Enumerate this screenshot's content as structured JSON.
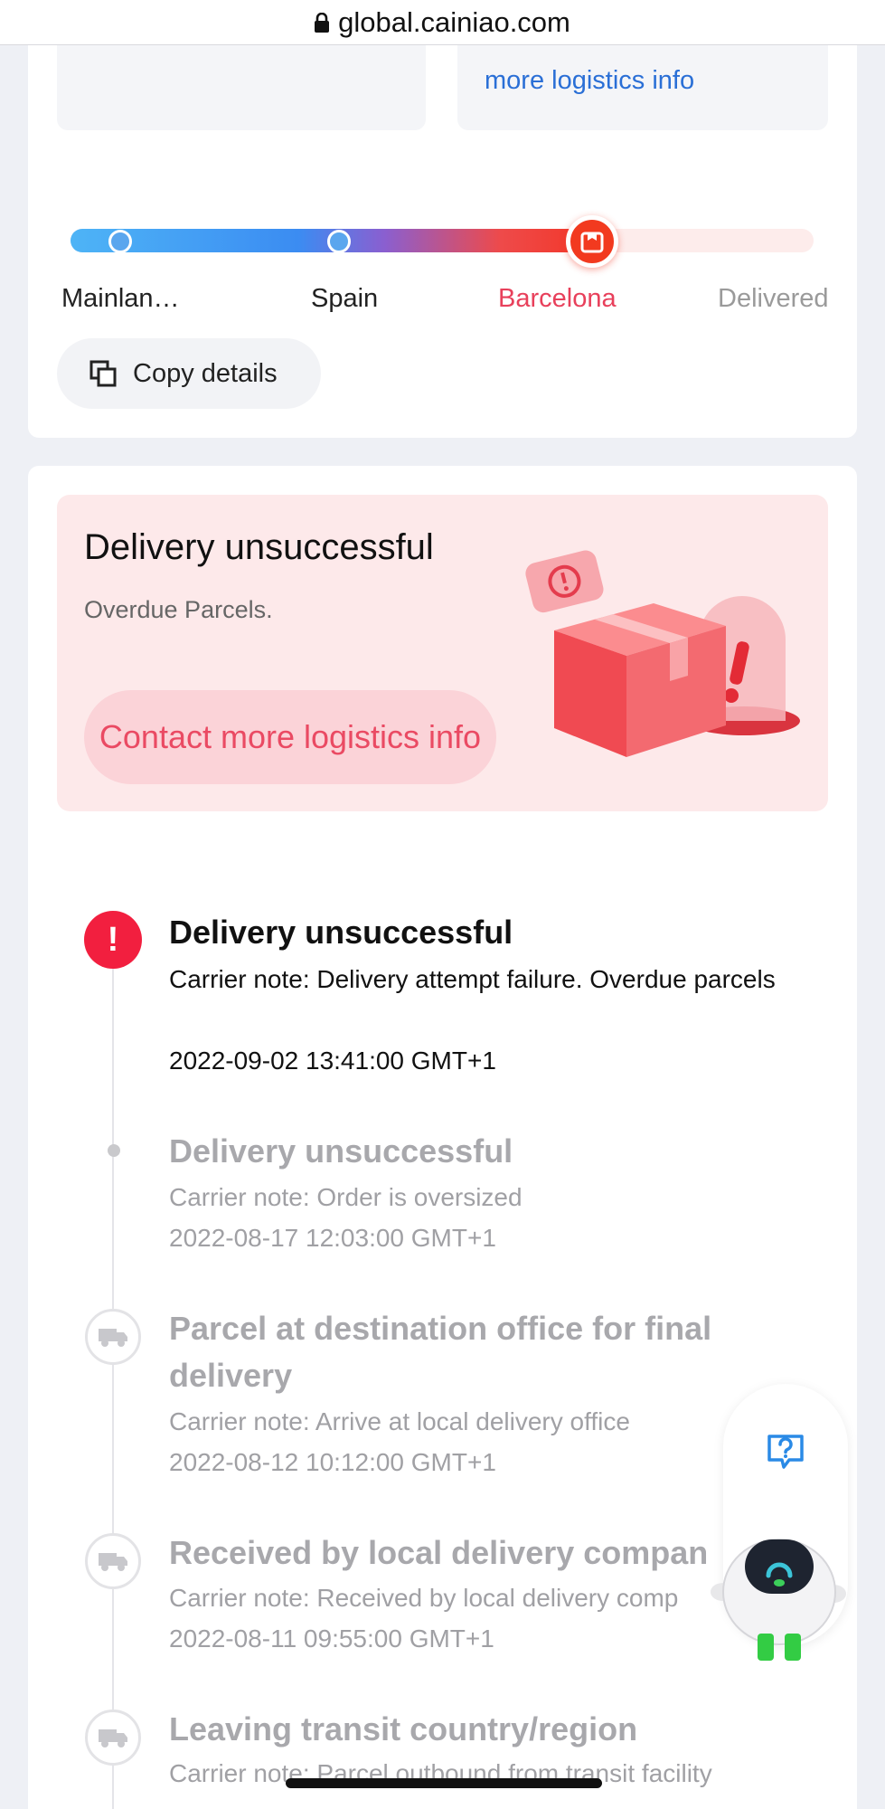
{
  "browser": {
    "url": "global.cainiao.com"
  },
  "top_card": {
    "more_logistics_link": "more logistics info",
    "stages": [
      {
        "label": "Mainlan…",
        "state": "done"
      },
      {
        "label": "Spain",
        "state": "done"
      },
      {
        "label": "Barcelona",
        "state": "current"
      },
      {
        "label": "Delivered",
        "state": "future"
      }
    ],
    "copy_button": "Copy details"
  },
  "status_panel": {
    "title": "Delivery unsuccessful",
    "subtitle": "Overdue Parcels.",
    "contact_button": "Contact more logistics info"
  },
  "timeline": [
    {
      "title": "Delivery unsuccessful",
      "note": "Carrier note: Delivery attempt failure. Overdue parcels",
      "time": "2022-09-02 13:41:00 GMT+1",
      "icon": "alert-icon",
      "active": true
    },
    {
      "title": "Delivery unsuccessful",
      "note": "Carrier note: Order is oversized",
      "time": "2022-08-17 12:03:00 GMT+1",
      "icon": "dot-icon",
      "active": false
    },
    {
      "title": "Parcel at destination office for final delivery",
      "note": "Carrier note: Arrive at local delivery office",
      "time": "2022-08-12 10:12:00 GMT+1",
      "icon": "truck-icon",
      "active": false
    },
    {
      "title": "Received by local delivery compan",
      "note": "Carrier note: Received by local delivery comp",
      "time": "2022-08-11 09:55:00 GMT+1",
      "icon": "truck-icon",
      "active": false
    },
    {
      "title": "Leaving transit country/region",
      "note": "Carrier note: Parcel outbound from transit facility",
      "time": "",
      "icon": "truck-icon",
      "active": false
    }
  ],
  "colors": {
    "accent_red": "#f21f3f",
    "link_blue": "#2a6fd6",
    "current_stage": "#e8405b"
  }
}
